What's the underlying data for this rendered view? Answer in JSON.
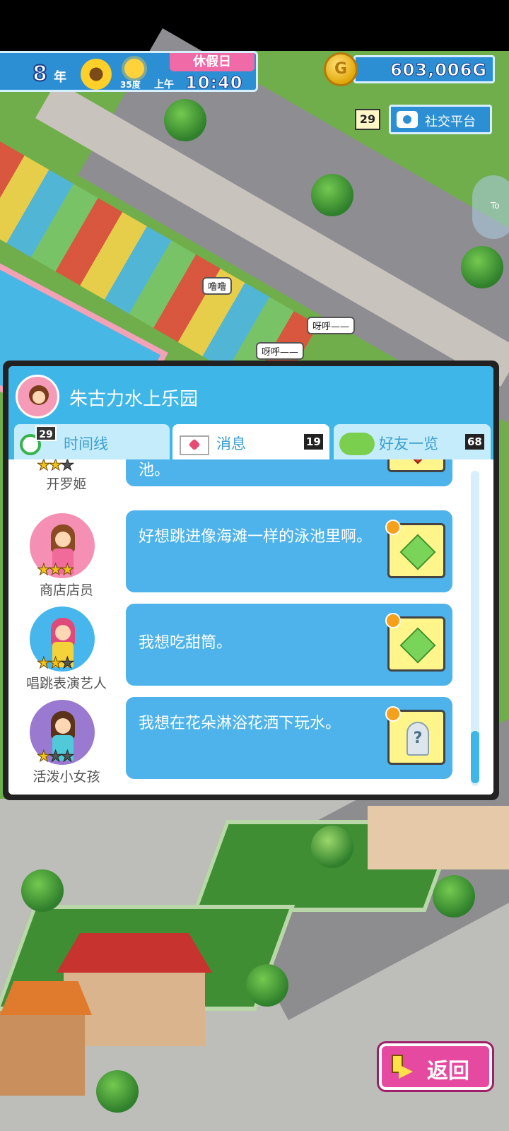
{
  "hud": {
    "year_value": "8",
    "year_unit": "年",
    "temperature": "35度",
    "am_pm": "上午",
    "time": "10:40",
    "holiday": "休假日",
    "money": "603,006G",
    "coin_symbol": "G"
  },
  "social": {
    "badge": "29",
    "label": "社交平台"
  },
  "side_handle": {
    "label": "To"
  },
  "scene_bubbles": {
    "b1": "噜噜",
    "b2": "呀呼——",
    "b3": "呀呼——"
  },
  "panel": {
    "park_name": "朱古力水上乐园",
    "tabs": [
      {
        "label": "时间线",
        "count": "29"
      },
      {
        "label": "消息",
        "count": "19"
      },
      {
        "label": "好友一览",
        "count": "68"
      }
    ],
    "messages": [
      {
        "name": "开罗姬",
        "text": "池。",
        "stars": 2,
        "gift": "red"
      },
      {
        "name": "商店店员",
        "text": "好想跳进像海滩一样的泳池里啊。",
        "stars": 3,
        "gift": "green"
      },
      {
        "name": "唱跳表演艺人",
        "text": "我想吃甜筒。",
        "stars": 2,
        "gift": "green"
      },
      {
        "name": "活泼小女孩",
        "text": "我想在花朵淋浴花洒下玩水。",
        "stars": 1,
        "gift": "mystery"
      }
    ]
  },
  "back_button": {
    "label": "返回"
  },
  "colors": {
    "hud_blue": "#2c8fd4",
    "panel_blue": "#3fb6e8",
    "bubble_blue": "#4db3ea",
    "holiday_pink": "#f06aa7",
    "back_pink": "#e64aa0"
  }
}
